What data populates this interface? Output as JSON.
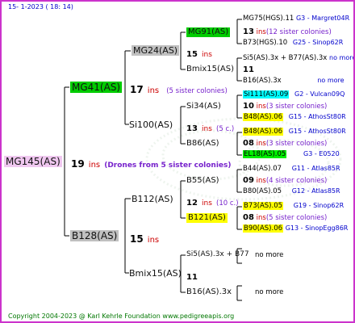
{
  "header": {
    "date": "15-  1-2023 ( 18: 14)"
  },
  "footer": {
    "copyright": "Copyright 2004-2023 @ Karl Kehrle Foundation    www.pedigreeapis.org"
  },
  "colors": {
    "border": "#cc33cc",
    "lines": "#000000",
    "green_box": "#00cc00",
    "gray_box": "#c0c0c0",
    "yellow_box": "#ffff00",
    "cyan_box": "#00ffff",
    "green_box2": "#00ee00"
  },
  "root": {
    "name": "MG145(AS)",
    "ins": "19",
    "ins_suffix": "ins",
    "note": "(Drones from 5 sister colonies)"
  },
  "gen1": [
    {
      "name": "MG41(AS)",
      "ins": "17",
      "ins_suffix": "ins",
      "note": "(5 sister colonies)"
    },
    {
      "name": "B128(AS)",
      "ins": "15",
      "ins_suffix": "ins"
    }
  ],
  "gen2": [
    {
      "name": "MG24(AS)",
      "ins": "15",
      "ins_suffix": "ins"
    },
    {
      "name": "Si100(AS)",
      "ins": "13",
      "ins_suffix": "ins",
      "note": "(5 c.)"
    },
    {
      "name": "B112(AS)",
      "ins": "12",
      "ins_suffix": "ins",
      "note": "(10 c.)"
    },
    {
      "name": "Bmix15(AS)",
      "ins": "11",
      "ins_suffix": ""
    }
  ],
  "gen3": [
    {
      "name": "MG91(AS)"
    },
    {
      "name": "Bmix15(AS)",
      "ins": "11"
    },
    {
      "name": "Si34(AS)"
    },
    {
      "name": "B86(AS)"
    },
    {
      "name": "B55(AS)"
    },
    {
      "name": "B121(AS)"
    },
    {
      "name": "Si5(AS).3x + B77",
      "extra": "no more"
    },
    {
      "name": "B16(AS).3x",
      "extra": "no more"
    }
  ],
  "gen4": [
    {
      "name": "MG75(HGS).11",
      "info": "G3 - Margret04R"
    },
    {
      "num": "13",
      "ins": "ins",
      "note": "(12 sister colonies)"
    },
    {
      "name": "B73(HGS).10",
      "info": "G25 - Sinop62R"
    },
    {
      "name": "Si5(AS).3x + B77(AS).3x",
      "info": "no more"
    },
    {
      "num": "11"
    },
    {
      "name": "B16(AS).3x",
      "info": "no more"
    },
    {
      "name": "Si111(AS).09",
      "info": "G2 - Vulcan09Q"
    },
    {
      "num": "10",
      "ins": "ins",
      "note": "(3 sister colonies)"
    },
    {
      "name": "B48(AS).06",
      "info": "G15 - AthosSt80R"
    },
    {
      "name": "B48(AS).06",
      "info": "G15 - AthosSt80R"
    },
    {
      "num": "08",
      "ins": "ins",
      "note": "(3 sister colonies)"
    },
    {
      "name": "EL18(AS).05",
      "info": "G3 - E0520"
    },
    {
      "name": "B44(AS).07",
      "info": "G11 - Atlas85R"
    },
    {
      "num": "09",
      "ins": "ins",
      "note": "(4 sister colonies)"
    },
    {
      "name": "B80(AS).05",
      "info": "G12 - Atlas85R"
    },
    {
      "name": "B73(AS).05",
      "info": "G19 - Sinop62R"
    },
    {
      "num": "08",
      "ins": "ins",
      "note": "(5 sister colonies)"
    },
    {
      "name": "B90(AS).06",
      "info": "G13 - SinopEgg86R"
    }
  ]
}
